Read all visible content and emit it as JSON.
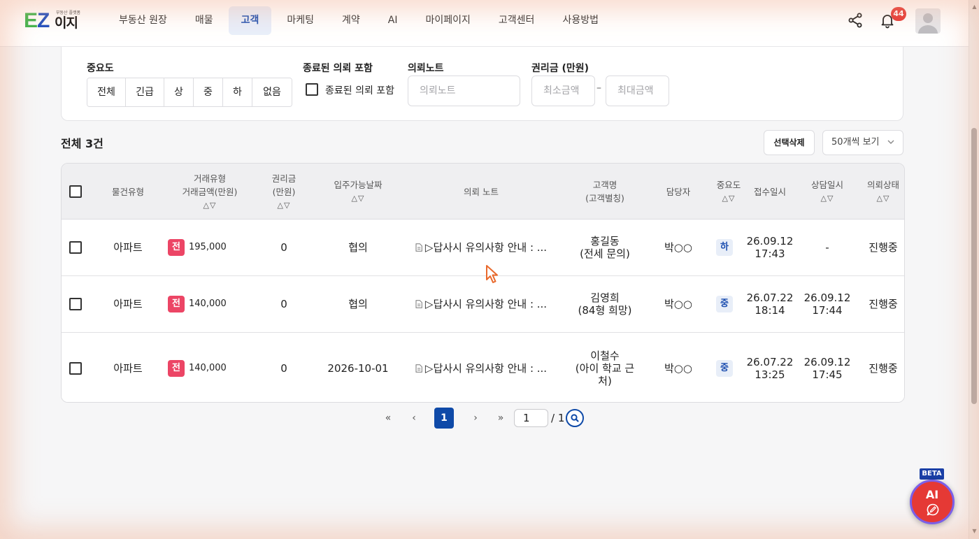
{
  "logo": {
    "ez": "EZ",
    "kor": "이지",
    "tagline": "부동산 플랫폼"
  },
  "nav": [
    {
      "label": "부동산 원장",
      "active": false
    },
    {
      "label": "매물",
      "active": false
    },
    {
      "label": "고객",
      "active": true
    },
    {
      "label": "마케팅",
      "active": false
    },
    {
      "label": "계약",
      "active": false
    },
    {
      "label": "AI",
      "active": false
    },
    {
      "label": "마이페이지",
      "active": false
    },
    {
      "label": "고객센터",
      "active": false
    },
    {
      "label": "사용방법",
      "active": false
    }
  ],
  "header": {
    "notification_count": "44"
  },
  "filters": {
    "importance_label": "중요도",
    "importance_options": [
      "전체",
      "긴급",
      "상",
      "중",
      "하",
      "없음"
    ],
    "closed_label": "종료된 의뢰 포함",
    "closed_checkbox_label": "종료된 의뢰 포함",
    "note_label": "의뢰노트",
    "note_placeholder": "의뢰노트",
    "premium_label": "권리금 (만원)",
    "premium_min_placeholder": "최소금액",
    "premium_max_placeholder": "최대금액",
    "dash": "–"
  },
  "list": {
    "total": "전체 3건",
    "delete_button": "선택삭제",
    "per_page": "50개씩 보기"
  },
  "table": {
    "headers": {
      "property_type": "물건유형",
      "deal_line1": "거래유형",
      "deal_line2": "거래금액(만원)",
      "premium_line1": "권리금",
      "premium_line2": "(만원)",
      "move_in": "입주가능날짜",
      "note": "의뢰 노트",
      "customer_line1": "고객명",
      "customer_line2": "(고객별칭)",
      "manager": "담당자",
      "importance": "중요도",
      "received": "접수일시",
      "consulted": "상담일시",
      "status": "의뢰상태",
      "sort": "△▽"
    },
    "rows": [
      {
        "property_type": "아파트",
        "deal_type": "전",
        "amount": "195,000",
        "premium": "0",
        "move_in": "협의",
        "note": "▷답사시 유의사항 안내 : ...",
        "customer_lines": [
          "홍길동",
          "(전세 문의)"
        ],
        "manager": "박○○",
        "importance": "하",
        "received_lines": [
          "26.09.12",
          "17:43"
        ],
        "consulted_lines": [
          "-"
        ],
        "status": "진행중"
      },
      {
        "property_type": "아파트",
        "deal_type": "전",
        "amount": "140,000",
        "premium": "0",
        "move_in": "협의",
        "note": "▷답사시 유의사항 안내 : ...",
        "customer_lines": [
          "김영희",
          "(84형 희망)"
        ],
        "manager": "박○○",
        "importance": "중",
        "received_lines": [
          "26.07.22",
          "18:14"
        ],
        "consulted_lines": [
          "26.09.12",
          "17:44"
        ],
        "status": "진행중"
      },
      {
        "property_type": "아파트",
        "deal_type": "전",
        "amount": "140,000",
        "premium": "0",
        "move_in": "2026-10-01",
        "note": "▷답사시 유의사항 안내 : ...",
        "customer_lines": [
          "이철수",
          "(아이 학교 근",
          "처)"
        ],
        "manager": "박○○",
        "importance": "중",
        "received_lines": [
          "26.07.22",
          "13:25"
        ],
        "consulted_lines": [
          "26.09.12",
          "17:45"
        ],
        "status": "진행중"
      }
    ]
  },
  "pagination": {
    "first": "«",
    "prev": "‹",
    "current": "1",
    "next": "›",
    "last": "»",
    "input_value": "1",
    "total": "/ 1"
  },
  "ai": {
    "beta": "BETA",
    "label": "AI"
  },
  "colors": {
    "brand_blue": "#1f4fbf",
    "brand_green": "#3cb44b",
    "deal_badge": "#ec4565",
    "ai_red": "#e53935"
  }
}
